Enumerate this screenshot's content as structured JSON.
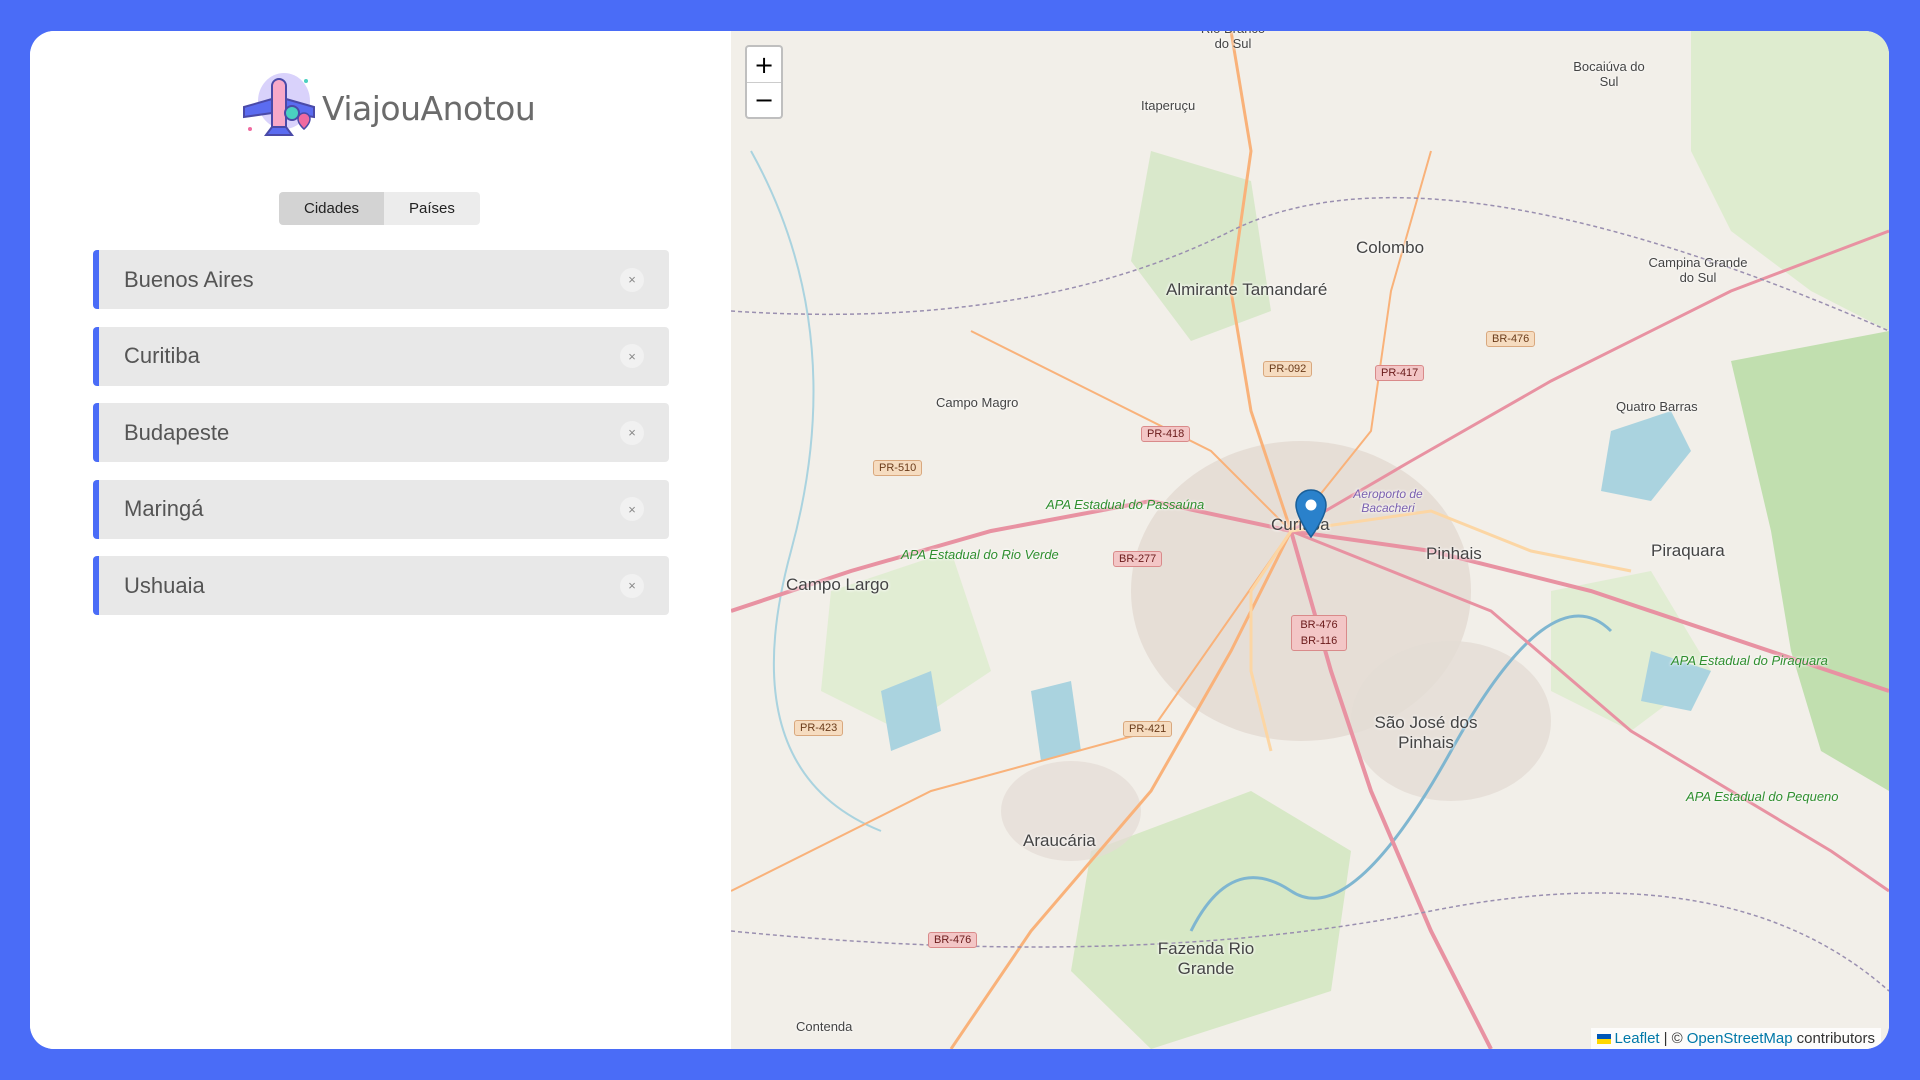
{
  "app": {
    "name": "ViajouAnotou"
  },
  "tabs": [
    {
      "label": "Cidades",
      "active": true
    },
    {
      "label": "Países",
      "active": false
    }
  ],
  "cities": [
    {
      "name": "Buenos Aires"
    },
    {
      "name": "Curitiba"
    },
    {
      "name": "Budapeste"
    },
    {
      "name": "Maringá"
    },
    {
      "name": "Ushuaia"
    }
  ],
  "remove_symbol": "×",
  "map": {
    "zoom_in": "+",
    "zoom_out": "−",
    "labels": {
      "curitiba": "Curitiba",
      "colombo": "Colombo",
      "almirante": "Almirante Tamandaré",
      "campo_largo": "Campo Largo",
      "campo_magro": "Campo Magro",
      "pinhais": "Pinhais",
      "piraquara": "Piraquara",
      "sao_jose": "São José dos Pinhais",
      "araucaria": "Araucária",
      "fazenda": "Fazenda Rio Grande",
      "quatro_barras": "Quatro Barras",
      "campina": "Campina Grande do Sul",
      "bocaiuva": "Bocaiúva do Sul",
      "itaperucu": "Itaperuçu",
      "rio_branco": "Rio Branco do Sul",
      "contenda": "Contenda",
      "apa_passauna": "APA Estadual do Passaúna",
      "apa_rio_verde": "APA Estadual do Rio Verde",
      "apa_piraquara": "APA Estadual do Piraquara",
      "apa_pequeno": "APA Estadual do Pequeno",
      "aeroporto": "Aeroporto de Bacacheri"
    },
    "shields": {
      "br476_n": "BR-476",
      "pr092": "PR-092",
      "pr417": "PR-417",
      "pr418": "PR-418",
      "pr510": "PR-510",
      "br277": "BR-277",
      "br476_116": "BR-476 BR-116",
      "pr423": "PR-423",
      "pr421": "PR-421",
      "br476_s": "BR-476"
    },
    "attribution": {
      "leaflet": "Leaflet",
      "separator": "| ©",
      "osm": "OpenStreetMap",
      "contributors": "contributors"
    }
  },
  "colors": {
    "frame": "#4a6cf7",
    "accent": "#4a6cf7",
    "item_bg": "#e8e8e8",
    "marker": "#2a81cb"
  }
}
